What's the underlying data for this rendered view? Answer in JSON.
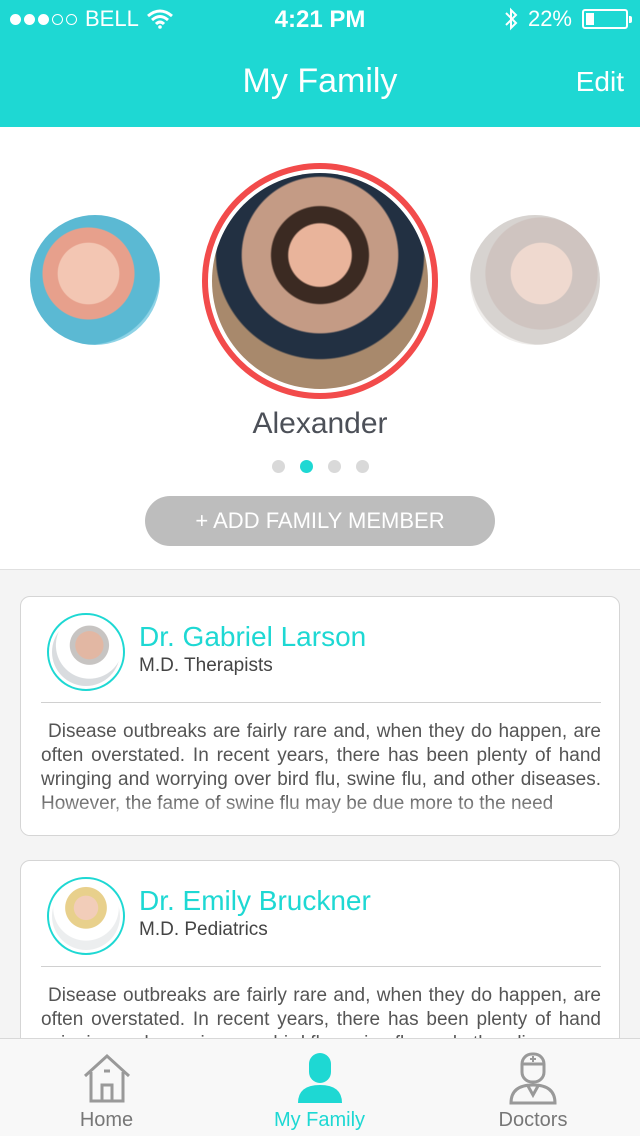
{
  "status": {
    "carrier": "BELL",
    "time": "4:21 PM",
    "battery": "22%",
    "battery_level": 0.22
  },
  "nav": {
    "title": "My Family",
    "edit": "Edit"
  },
  "profiles": {
    "selected_name": "Alexander",
    "page_count": 4,
    "active_page": 2,
    "add_button": "+ ADD FAMILY MEMBER"
  },
  "doctors": [
    {
      "name": "Dr. Gabriel Larson",
      "specialty": "M.D. Therapists",
      "description": "Disease outbreaks are fairly rare and, when they do happen, are often overstated. In recent years, there has been plenty of hand wringing and worrying over bird flu, swine flu, and other diseases. However, the fame of swine flu may be due more to the need"
    },
    {
      "name": "Dr. Emily Bruckner",
      "specialty": "M.D. Pediatrics",
      "description": "Disease outbreaks are fairly rare and, when they do happen, are often overstated. In recent years, there has been plenty of hand wringing and worrying over bird flu, swine flu, and other diseases."
    }
  ],
  "tabs": [
    {
      "label": "Home",
      "icon": "home-icon"
    },
    {
      "label": "My Family",
      "icon": "person-icon"
    },
    {
      "label": "Doctors",
      "icon": "doctor-icon"
    }
  ],
  "colors": {
    "accent": "#1ed8d3",
    "ring": "#f24b4b",
    "button": "#bdbdbd"
  }
}
